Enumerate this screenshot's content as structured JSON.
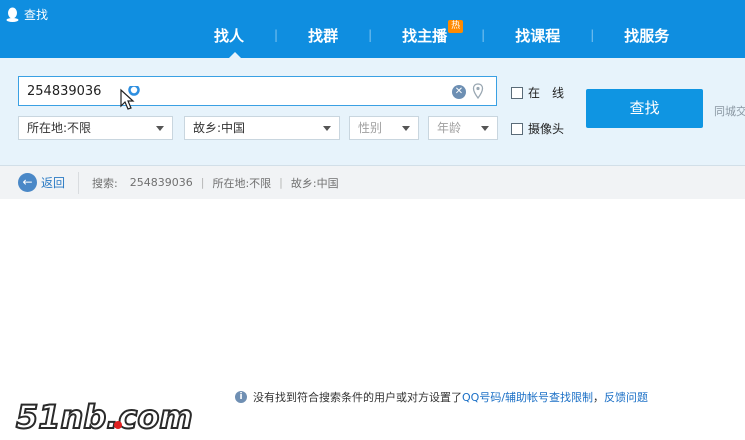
{
  "window": {
    "title": "查找"
  },
  "tabs": [
    {
      "label": "找人",
      "active": true
    },
    {
      "label": "找群",
      "active": false
    },
    {
      "label": "找主播",
      "active": false,
      "badge": "热"
    },
    {
      "label": "找课程",
      "active": false
    },
    {
      "label": "找服务",
      "active": false
    }
  ],
  "search": {
    "value": "254839036"
  },
  "filters": {
    "location": "所在地:不限",
    "hometown": "故乡:中国",
    "gender": "性别",
    "age": "年龄"
  },
  "checks": {
    "online": "在　线",
    "camera": "摄像头"
  },
  "find_button": "查找",
  "city_link": "同城交",
  "breadcrumb": {
    "back": "返回",
    "search_label": "搜索:",
    "search_value": "254839036",
    "location": "所在地:不限",
    "hometown": "故乡:中国"
  },
  "message": {
    "text": "没有找到符合搜索条件的用户或对方设置了",
    "link1": "QQ号码/辅助帐号查找限制",
    "sep": "，",
    "link2": "反馈问题"
  },
  "watermark": "51nb.com",
  "colors": {
    "brand": "#0f8ee0",
    "panel": "#e7f3fb",
    "button": "#0f95e2",
    "link": "#1a6fc6"
  }
}
